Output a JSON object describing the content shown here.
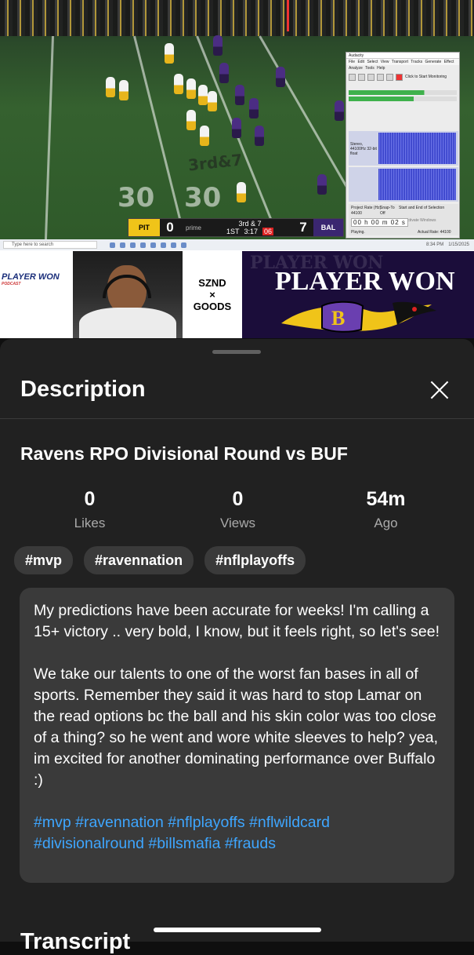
{
  "video": {
    "field_numbers": [
      "30",
      "30"
    ],
    "down_marker": "3rd&7",
    "scoreboard": {
      "home_team": "PIT",
      "home_record": "10-7",
      "home_score": "0",
      "network": "prime",
      "down_distance": "3rd & 7",
      "quarter": "1ST",
      "clock": "3:17",
      "play_clock": "06",
      "away_score": "7",
      "away_team": "BAL",
      "away_record": "13-4"
    },
    "audacity": {
      "title": "Audacity",
      "menu": "File Edit Select View Transport Tracks Generate Effect Analyze Tools Help",
      "monitor_label": "Click to Start Monitoring",
      "track_label": "Stereo, 44100Hz 32-bit float",
      "project_rate_label": "Project Rate (Hz)",
      "project_rate": "44100",
      "snap_label": "Snap-To",
      "snap_value": "Off",
      "selection_label": "Start and End of Selection",
      "time": "00 h 00 m 02 s",
      "status": "Playing.",
      "actual_rate": "Actual Rate: 44100",
      "activate": "Activate Windows"
    },
    "taskbar": {
      "search_placeholder": "Type here to search",
      "time": "8:34 PM",
      "date": "1/15/2025"
    }
  },
  "overlay": {
    "left_logo": "PLAYER WON",
    "left_logo_sub": "PODCAST",
    "sponsor_line1": "SZND",
    "sponsor_line2": "×",
    "sponsor_line3": "GOODS",
    "banner_bg_text": "PLAYER WON",
    "banner_title": "PLAYER WON"
  },
  "description_panel": {
    "title": "Description",
    "video_title": "Ravens RPO Divisional Round vs BUF",
    "stats": [
      {
        "value": "0",
        "label": "Likes"
      },
      {
        "value": "0",
        "label": "Views"
      },
      {
        "value": "54m",
        "label": "Ago"
      }
    ],
    "tags": [
      "#mvp",
      "#ravennation",
      "#nflplayoffs"
    ],
    "paragraph1": "My predictions have been accurate for weeks! I'm calling a 15+ victory .. very bold, I know, but it feels right, so let's see!",
    "paragraph2": "We take our talents to one of the worst fan bases in all of sports. Remember they said it was hard to stop Lamar on the read options bc the ball and his skin color was too close of a thing? so he went and wore white sleeves to help? yea, im excited for another dominating performance over Buffalo :)",
    "hashtags": [
      "#mvp",
      "#ravennation",
      "#nflplayoffs",
      "#nflwildcard",
      "#divisionalround",
      "#billsmafia",
      "#frauds"
    ],
    "next_section": "Transcript"
  },
  "colors": {
    "background": "#0f0f0f",
    "sheet": "#212121",
    "card": "#3a3a3a",
    "link": "#3ea6ff",
    "muted": "#aaaaaa",
    "ravens_purple": "#1b0d3a",
    "steelers_gold": "#f0c419"
  },
  "icons": {
    "close": "close-icon",
    "handle": "drag-handle-icon"
  }
}
